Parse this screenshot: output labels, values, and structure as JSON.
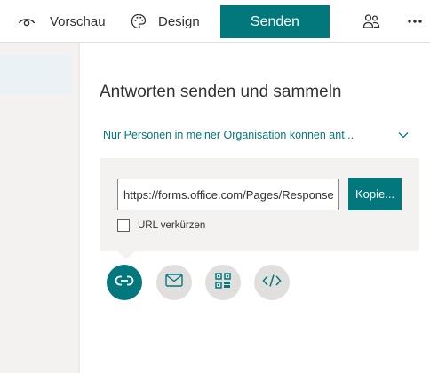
{
  "toolbar": {
    "preview_label": "Vorschau",
    "design_label": "Design",
    "send_label": "Senden",
    "icons": {
      "preview": "eye-icon",
      "design": "palette-icon",
      "collaborate": "people-icon",
      "more": "more-icon"
    }
  },
  "panel": {
    "title": "Antworten senden und sammeln",
    "audience_label": "Nur Personen in meiner Organisation können ant...",
    "url_value": "https://forms.office.com/Pages/ResponsePage.aspx",
    "copy_label": "Kopie...",
    "shorten_label": "URL verkürzen",
    "shorten_checked": false,
    "share_options": [
      "link-icon",
      "mail-icon",
      "qr-code-icon",
      "embed-icon"
    ],
    "active_option": "link-icon"
  },
  "colors": {
    "accent": "#03787c",
    "panel_background": "#ffffff",
    "page_background": "#f3f2f1"
  }
}
